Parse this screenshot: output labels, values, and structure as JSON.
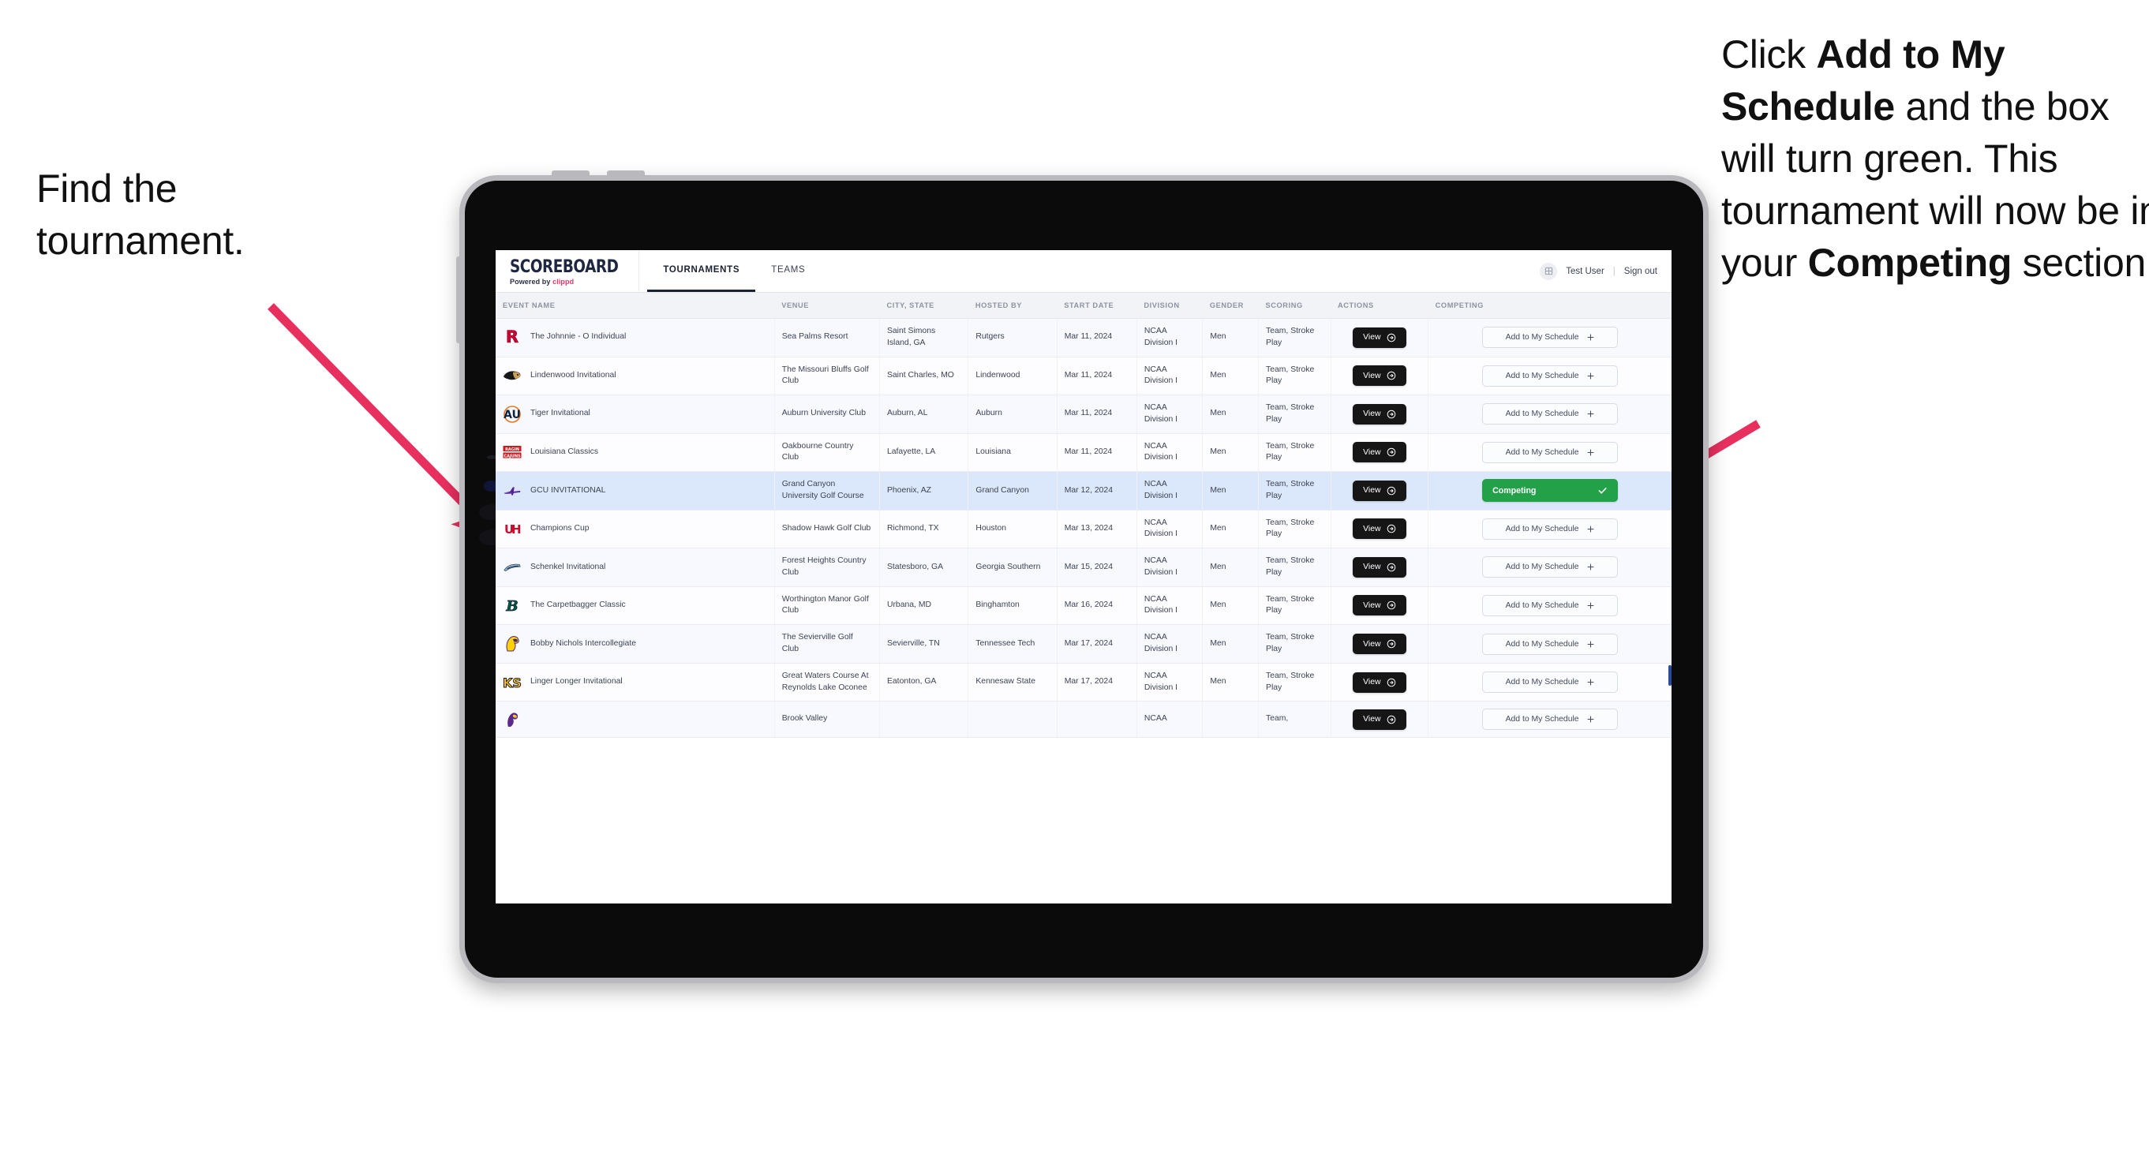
{
  "annotations": {
    "left": {
      "line1": "Find the",
      "line2": "tournament."
    },
    "right": {
      "seg1": "Click ",
      "bold1": "Add to My Schedule",
      "seg2": " and the box will turn green. This tournament will now be in your ",
      "bold2": "Competing",
      "seg3": " section."
    },
    "arrow_color": "#e8305f"
  },
  "app": {
    "brand": {
      "wordmark": "SCOREBOARD",
      "powered_prefix": "Powered by ",
      "powered_brand": "clippd"
    },
    "tabs": [
      {
        "label": "TOURNAMENTS",
        "active": true
      },
      {
        "label": "TEAMS",
        "active": false
      }
    ],
    "account": {
      "avatar_icon": "user-avatar-icon",
      "user": "Test User",
      "separator": "|",
      "signout": "Sign out"
    }
  },
  "table": {
    "columns": [
      "EVENT NAME",
      "VENUE",
      "CITY, STATE",
      "HOSTED BY",
      "START DATE",
      "DIVISION",
      "GENDER",
      "SCORING",
      "ACTIONS",
      "COMPETING"
    ],
    "view_label": "View",
    "add_label": "Add to My Schedule",
    "competing_label": "Competing",
    "rows": [
      {
        "logo": "rutgers-logo",
        "event": "The Johnnie - O Individual",
        "venue": "Sea Palms Resort",
        "city": "Saint Simons Island, GA",
        "host": "Rutgers",
        "date": "Mar 11, 2024",
        "division": "NCAA Division I",
        "gender": "Men",
        "scoring": "Team, Stroke Play",
        "competing": false
      },
      {
        "logo": "lindenwood-logo",
        "event": "Lindenwood Invitational",
        "venue": "The Missouri Bluffs Golf Club",
        "city": "Saint Charles, MO",
        "host": "Lindenwood",
        "date": "Mar 11, 2024",
        "division": "NCAA Division I",
        "gender": "Men",
        "scoring": "Team, Stroke Play",
        "competing": false
      },
      {
        "logo": "auburn-logo",
        "event": "Tiger Invitational",
        "venue": "Auburn University Club",
        "city": "Auburn, AL",
        "host": "Auburn",
        "date": "Mar 11, 2024",
        "division": "NCAA Division I",
        "gender": "Men",
        "scoring": "Team, Stroke Play",
        "competing": false
      },
      {
        "logo": "louisiana-logo",
        "event": "Louisiana Classics",
        "venue": "Oakbourne Country Club",
        "city": "Lafayette, LA",
        "host": "Louisiana",
        "date": "Mar 11, 2024",
        "division": "NCAA Division I",
        "gender": "Men",
        "scoring": "Team, Stroke Play",
        "competing": false
      },
      {
        "logo": "grandcanyon-logo",
        "event": "GCU INVITATIONAL",
        "venue": "Grand Canyon University Golf Course",
        "city": "Phoenix, AZ",
        "host": "Grand Canyon",
        "date": "Mar 12, 2024",
        "division": "NCAA Division I",
        "gender": "Men",
        "scoring": "Team, Stroke Play",
        "competing": true
      },
      {
        "logo": "houston-logo",
        "event": "Champions Cup",
        "venue": "Shadow Hawk Golf Club",
        "city": "Richmond, TX",
        "host": "Houston",
        "date": "Mar 13, 2024",
        "division": "NCAA Division I",
        "gender": "Men",
        "scoring": "Team, Stroke Play",
        "competing": false
      },
      {
        "logo": "georgiasouthern-logo",
        "event": "Schenkel Invitational",
        "venue": "Forest Heights Country Club",
        "city": "Statesboro, GA",
        "host": "Georgia Southern",
        "date": "Mar 15, 2024",
        "division": "NCAA Division I",
        "gender": "Men",
        "scoring": "Team, Stroke Play",
        "competing": false
      },
      {
        "logo": "binghamton-logo",
        "event": "The Carpetbagger Classic",
        "venue": "Worthington Manor Golf Club",
        "city": "Urbana, MD",
        "host": "Binghamton",
        "date": "Mar 16, 2024",
        "division": "NCAA Division I",
        "gender": "Men",
        "scoring": "Team, Stroke Play",
        "competing": false
      },
      {
        "logo": "tennesseetech-logo",
        "event": "Bobby Nichols Intercollegiate",
        "venue": "The Sevierville Golf Club",
        "city": "Sevierville, TN",
        "host": "Tennessee Tech",
        "date": "Mar 17, 2024",
        "division": "NCAA Division I",
        "gender": "Men",
        "scoring": "Team, Stroke Play",
        "competing": false
      },
      {
        "logo": "kennesawstate-logo",
        "event": "Linger Longer Invitational",
        "venue": "Great Waters Course At Reynolds Lake Oconee",
        "city": "Eatonton, GA",
        "host": "Kennesaw State",
        "date": "Mar 17, 2024",
        "division": "NCAA Division I",
        "gender": "Men",
        "scoring": "Team, Stroke Play",
        "competing": false
      },
      {
        "logo": "eastcarolina-logo",
        "event": "",
        "venue": "Brook Valley",
        "city": "",
        "host": "",
        "date": "",
        "division": "NCAA",
        "gender": "",
        "scoring": "Team,",
        "competing": false
      }
    ]
  },
  "colors": {
    "accent_pink": "#ee3264",
    "competing_green": "#22a148",
    "selected_row": "#dbe7fb",
    "dark_button": "#161616"
  }
}
